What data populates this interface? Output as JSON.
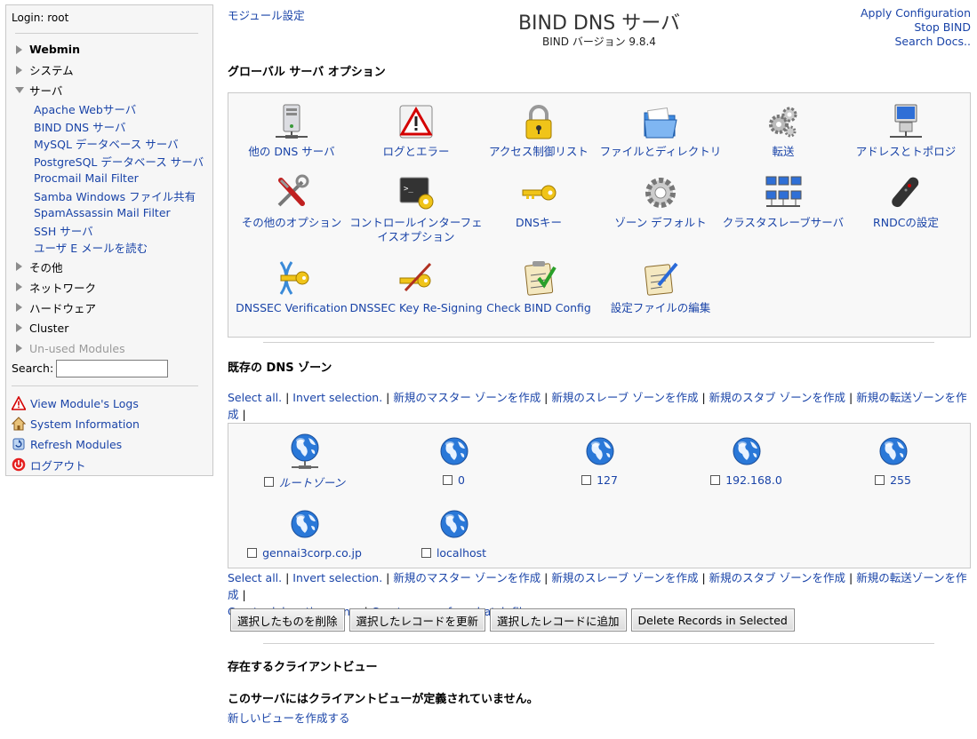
{
  "sidebar": {
    "login": "Login: root",
    "categories_top": [
      {
        "label": "Webmin",
        "bold": true
      },
      {
        "label": "システム"
      },
      {
        "label": "サーバ",
        "open": true
      }
    ],
    "server_items": [
      "Apache Webサーバ",
      "BIND DNS サーバ",
      "MySQL データベース サーバ",
      "PostgreSQL データベース サーバ",
      "Procmail Mail Filter",
      "Samba Windows ファイル共有",
      "SpamAssassin Mail Filter",
      "SSH サーバ",
      "ユーザ E メールを読む"
    ],
    "categories_bottom": [
      {
        "label": "その他"
      },
      {
        "label": "ネットワーク"
      },
      {
        "label": "ハードウェア"
      },
      {
        "label": "Cluster"
      },
      {
        "label": "Un-used Modules",
        "gray": true
      }
    ],
    "search_label": "Search:",
    "tools": {
      "logs": "View Module's Logs",
      "sysinfo": "System Information",
      "refresh": "Refresh Modules",
      "logout": "ログアウト"
    }
  },
  "header": {
    "module_config": "モジュール設定",
    "title": "BIND DNS サーバ",
    "version": "BIND バージョン 9.8.4",
    "apply": "Apply Configuration",
    "stop": "Stop BIND",
    "search_docs": "Search Docs.."
  },
  "global": {
    "title": "グローバル サーバ オプション",
    "icons": [
      {
        "label": "他の DNS サーバ",
        "icon": "server-icon"
      },
      {
        "label": "ログとエラー",
        "icon": "warning-icon"
      },
      {
        "label": "アクセス制御リスト",
        "icon": "padlock-icon"
      },
      {
        "label": "ファイルとディレクトリ",
        "icon": "folder-icon"
      },
      {
        "label": "転送",
        "icon": "gears-icon"
      },
      {
        "label": "アドレスとトポロジ",
        "icon": "network-computer-icon"
      },
      {
        "label": "その他のオプション",
        "icon": "tools-icon"
      },
      {
        "label": "コントロールインターフェイスオプション",
        "icon": "terminal-icon"
      },
      {
        "label": "DNSキー",
        "icon": "key-icon"
      },
      {
        "label": "ゾーン デフォルト",
        "icon": "gear-icon"
      },
      {
        "label": "クラスタスレーブサーバ",
        "icon": "cluster-icon"
      },
      {
        "label": "RNDCの設定",
        "icon": "remote-control-icon"
      },
      {
        "label": "DNSSEC Verification",
        "icon": "dnssec-key-icon"
      },
      {
        "label": "DNSSEC Key Re-Signing",
        "icon": "key-pen-icon"
      },
      {
        "label": "Check BIND Config",
        "icon": "checklist-icon"
      },
      {
        "label": "設定ファイルの編集",
        "icon": "edit-form-icon"
      }
    ]
  },
  "zones": {
    "title": "既存の DNS ゾーン",
    "links": {
      "select_all": "Select all.",
      "invert": "Invert selection.",
      "new_master": "新規のマスター ゾーンを作成",
      "new_slave": "新規のスレーブ ゾーンを作成",
      "new_stub": "新規のスタブ ゾーンを作成",
      "new_forward": "新規の転送ゾーンを作成",
      "delegation": "Create delegation zone.",
      "batch": "Create zones from batch file."
    },
    "items": [
      {
        "label": "ルートゾーン",
        "root": true,
        "italic": true
      },
      {
        "label": "0"
      },
      {
        "label": "127"
      },
      {
        "label": "192.168.0"
      },
      {
        "label": "255"
      },
      {
        "label": "gennai3corp.co.jp"
      },
      {
        "label": "localhost"
      }
    ],
    "buttons": {
      "delete": "選択したものを削除",
      "update": "選択したレコードを更新",
      "add": "選択したレコードに追加",
      "delete_records": "Delete Records in Selected"
    }
  },
  "views": {
    "title": "存在するクライアントビュー",
    "none": "このサーバにはクライアントビューが定義されていません。",
    "create": "新しいビューを作成する"
  }
}
